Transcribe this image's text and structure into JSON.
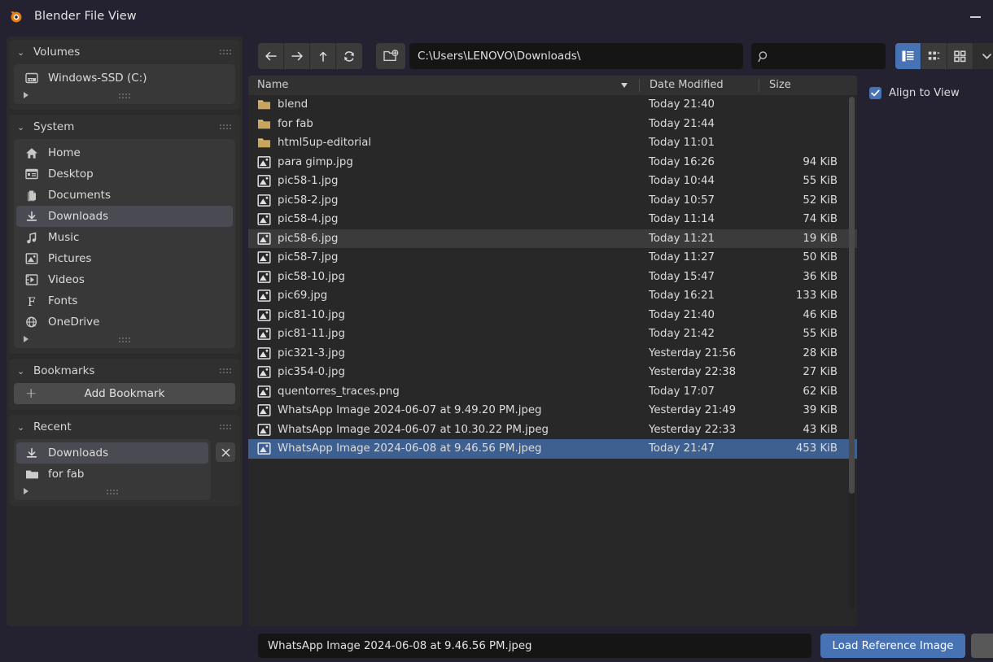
{
  "window": {
    "title": "Blender File View",
    "logo_icon": "blender-logo-icon",
    "minimize_icon": "minimize-icon"
  },
  "colors": {
    "accent_blue": "#4772b3",
    "selection_blue": "#3d6091",
    "panel_bg": "#303030",
    "sidebar_bg": "#2b2b2b",
    "field_bg": "#151515",
    "folder_icon": "#c8a45c"
  },
  "sidebar": {
    "panels": [
      {
        "title": "Volumes",
        "chevron": "⌄",
        "grip_icon": "grip-dots-icon",
        "items": [
          {
            "label": "Windows-SSD (C:)",
            "icon": "disk-drive-icon",
            "selected": false
          }
        ]
      },
      {
        "title": "System",
        "chevron": "⌄",
        "grip_icon": "grip-dots-icon",
        "items": [
          {
            "label": "Home",
            "icon": "home-icon",
            "selected": false
          },
          {
            "label": "Desktop",
            "icon": "desktop-icon",
            "selected": false
          },
          {
            "label": "Documents",
            "icon": "documents-icon",
            "selected": false
          },
          {
            "label": "Downloads",
            "icon": "download-icon",
            "selected": true
          },
          {
            "label": "Music",
            "icon": "music-note-icon",
            "selected": false
          },
          {
            "label": "Pictures",
            "icon": "picture-icon",
            "selected": false
          },
          {
            "label": "Videos",
            "icon": "film-icon",
            "selected": false
          },
          {
            "label": "Fonts",
            "icon": "font-f-icon",
            "selected": false
          },
          {
            "label": "OneDrive",
            "icon": "globe-icon",
            "selected": false
          }
        ]
      },
      {
        "title": "Bookmarks",
        "chevron": "⌄",
        "grip_icon": "grip-dots-icon",
        "add_bookmark_label": "Add Bookmark",
        "add_bookmark_icon": "plus-icon"
      },
      {
        "title": "Recent",
        "chevron": "⌄",
        "grip_icon": "grip-dots-icon",
        "clear_icon": "close-x-icon",
        "items": [
          {
            "label": "Downloads",
            "icon": "download-icon",
            "selected": true
          },
          {
            "label": "for fab",
            "icon": "folder-icon",
            "selected": false
          }
        ]
      }
    ]
  },
  "toolbar": {
    "nav": [
      {
        "name": "back",
        "icon": "arrow-left-icon"
      },
      {
        "name": "forward",
        "icon": "arrow-right-icon"
      },
      {
        "name": "up",
        "icon": "arrow-up-icon"
      },
      {
        "name": "refresh",
        "icon": "refresh-icon"
      }
    ],
    "new_folder_icon": "new-folder-icon",
    "path_value": "C:\\Users\\LENOVO\\Downloads\\",
    "path_placeholder": "",
    "search_value": "",
    "search_placeholder": "",
    "search_icon": "search-icon",
    "view_modes": [
      {
        "name": "vertical-list",
        "icon": "list-vertical-icon",
        "active": true
      },
      {
        "name": "horizontal-list",
        "icon": "list-horizontal-icon",
        "active": false
      },
      {
        "name": "thumbnails",
        "icon": "grid-icon",
        "active": false
      }
    ],
    "display_options_icon": "chevron-down-icon"
  },
  "filelist": {
    "columns": {
      "name": "Name",
      "date": "Date Modified",
      "size": "Size"
    },
    "sort_icon": "sort-descending-triangle-icon",
    "rows": [
      {
        "name": "blend",
        "date": "Today 21:40",
        "size": "",
        "icon": "folder-icon",
        "state": ""
      },
      {
        "name": "for fab",
        "date": "Today 21:44",
        "size": "",
        "icon": "folder-icon",
        "state": ""
      },
      {
        "name": "html5up-editorial",
        "date": "Today 11:01",
        "size": "",
        "icon": "folder-icon",
        "state": ""
      },
      {
        "name": "para gimp.jpg",
        "date": "Today 16:26",
        "size": "94 KiB",
        "icon": "image-file-icon",
        "state": ""
      },
      {
        "name": "pic58-1.jpg",
        "date": "Today 10:44",
        "size": "55 KiB",
        "icon": "image-file-icon",
        "state": ""
      },
      {
        "name": "pic58-2.jpg",
        "date": "Today 10:57",
        "size": "52 KiB",
        "icon": "image-file-icon",
        "state": ""
      },
      {
        "name": "pic58-4.jpg",
        "date": "Today 11:14",
        "size": "74 KiB",
        "icon": "image-file-icon",
        "state": ""
      },
      {
        "name": "pic58-6.jpg",
        "date": "Today 11:21",
        "size": "19 KiB",
        "icon": "image-file-icon",
        "state": "hover"
      },
      {
        "name": "pic58-7.jpg",
        "date": "Today 11:27",
        "size": "50 KiB",
        "icon": "image-file-icon",
        "state": ""
      },
      {
        "name": "pic58-10.jpg",
        "date": "Today 15:47",
        "size": "36 KiB",
        "icon": "image-file-icon",
        "state": ""
      },
      {
        "name": "pic69.jpg",
        "date": "Today 16:21",
        "size": "133 KiB",
        "icon": "image-file-icon",
        "state": ""
      },
      {
        "name": "pic81-10.jpg",
        "date": "Today 21:40",
        "size": "46 KiB",
        "icon": "image-file-icon",
        "state": ""
      },
      {
        "name": "pic81-11.jpg",
        "date": "Today 21:42",
        "size": "55 KiB",
        "icon": "image-file-icon",
        "state": ""
      },
      {
        "name": "pic321-3.jpg",
        "date": "Yesterday 21:56",
        "size": "28 KiB",
        "icon": "image-file-icon",
        "state": ""
      },
      {
        "name": "pic354-0.jpg",
        "date": "Yesterday 22:38",
        "size": "27 KiB",
        "icon": "image-file-icon",
        "state": ""
      },
      {
        "name": "quentorres_traces.png",
        "date": "Today 17:07",
        "size": "62 KiB",
        "icon": "image-file-icon",
        "state": ""
      },
      {
        "name": "WhatsApp Image 2024-06-07 at 9.49.20 PM.jpeg",
        "date": "Yesterday 21:49",
        "size": "39 KiB",
        "icon": "image-file-icon",
        "state": ""
      },
      {
        "name": "WhatsApp Image 2024-06-07 at 10.30.22 PM.jpeg",
        "date": "Yesterday 22:33",
        "size": "43 KiB",
        "icon": "image-file-icon",
        "state": ""
      },
      {
        "name": "WhatsApp Image 2024-06-08 at 9.46.56 PM.jpeg",
        "date": "Today 21:47",
        "size": "453 KiB",
        "icon": "image-file-icon",
        "state": "selected"
      }
    ]
  },
  "options": {
    "align_to_view": {
      "label": "Align to View",
      "checked": true,
      "check_icon": "checkmark-icon"
    }
  },
  "bottom": {
    "filename_value": "WhatsApp Image 2024-06-08 at 9.46.56 PM.jpeg",
    "filename_placeholder": "",
    "primary_button": "Load Reference Image",
    "secondary_button": ""
  }
}
